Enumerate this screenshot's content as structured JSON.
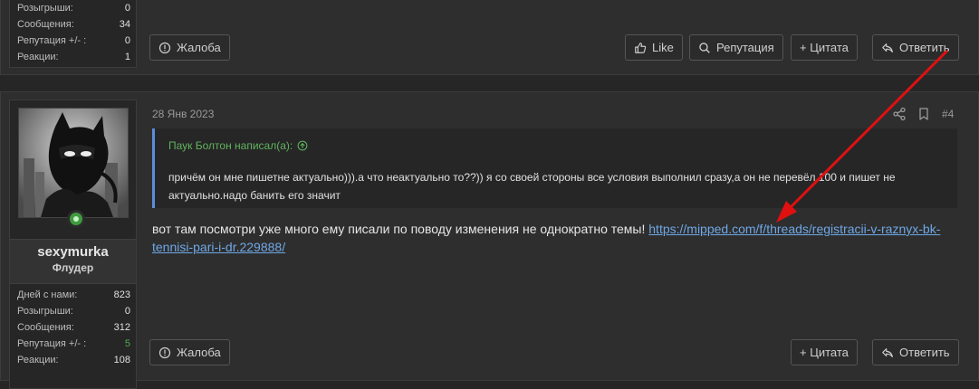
{
  "prev_post": {
    "stats": [
      {
        "label": "Розыгрыши:",
        "value": "0"
      },
      {
        "label": "Сообщения:",
        "value": "34"
      },
      {
        "label": "Репутация +/- :",
        "value": "0"
      },
      {
        "label": "Реакции:",
        "value": "1"
      }
    ],
    "actions": {
      "report": "Жалоба",
      "like": "Like",
      "reputation": "Репутация",
      "quote": "+ Цитата",
      "reply": "Ответить"
    }
  },
  "post": {
    "author": {
      "username": "sexymurka",
      "title": "Флудер",
      "online": true
    },
    "stats": [
      {
        "label": "Дней с нами:",
        "value": "823"
      },
      {
        "label": "Розыгрыши:",
        "value": "0"
      },
      {
        "label": "Сообщения:",
        "value": "312"
      },
      {
        "label": "Репутация +/- :",
        "value": "5"
      },
      {
        "label": "Реакции:",
        "value": "108"
      }
    ],
    "date": "28 Янв 2023",
    "number": "#4",
    "quote": {
      "header": "Паук Болтон написал(а):",
      "text": "причём он мне пишетне актуально))).а что неактуально то??)) я со своей стороны все условия выполнил сразу,а он не перевёл 100 и пишет не актуально.надо банить его значит"
    },
    "body": {
      "text": "вот там посмотри уже много ему писали по поводу изменения не однократно темы! ",
      "link": "https://mipped.com/f/threads/registracii-v-raznyx-bk-tennisi-pari-i-dr.229888/"
    },
    "actions": {
      "report": "Жалоба",
      "quote": "+ Цитата",
      "reply": "Ответить"
    }
  },
  "annotation": {
    "color": "#e01010"
  },
  "colors": {
    "link": "#6fa8e6",
    "quote_border": "#5b8dd9",
    "quote_header": "#5fb35f",
    "positive": "#4caf50"
  }
}
